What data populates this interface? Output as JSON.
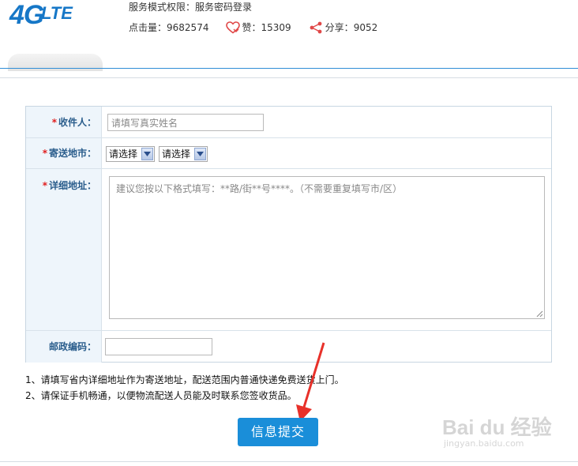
{
  "logo": {
    "main": "4G",
    "sub": "LTE"
  },
  "meta": {
    "permission_label": "服务模式权限：",
    "permission_value": "服务密码登录",
    "views_label": "点击量：",
    "views_value": "9682574",
    "likes_label": "赞：",
    "likes_value": "15309",
    "shares_label": "分享：",
    "shares_value": "9052"
  },
  "form": {
    "name": {
      "star": "*",
      "label": "收件人：",
      "placeholder": "请填写真实姓名"
    },
    "city": {
      "star": "*",
      "label": "寄送地市：",
      "city_selected": "请选择",
      "area_selected": "请选择"
    },
    "address": {
      "star": "*",
      "label": "详细地址：",
      "placeholder": "建议您按以下格式填写：**路/街**号****。（不需要重复填写市/区）"
    },
    "zip": {
      "label": "邮政编码：",
      "value": ""
    }
  },
  "notes": [
    "1、请填写省内详细地址作为寄送地址，配送范围内普通快递免费送货上门。",
    "2、请保证手机畅通，以便物流配送人员能及时联系您签收货品。"
  ],
  "submit_label": "信息提交",
  "watermark": {
    "main": "Bai du 经验",
    "sub": "jingyan.baidu.com"
  },
  "colors": {
    "accent": "#1a8ed9",
    "label_bg": "#eef5fb",
    "label_text": "#2a5d8c",
    "required": "#e02020",
    "annotation": "#e8312a"
  }
}
